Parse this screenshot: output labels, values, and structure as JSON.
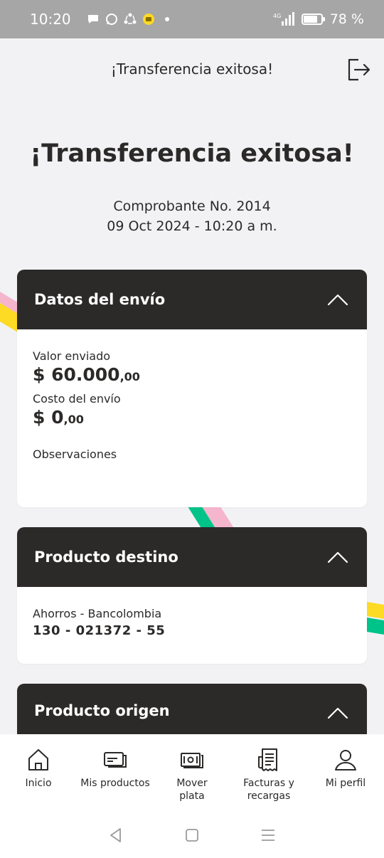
{
  "status_bar": {
    "time": "10:20",
    "battery": "78 %",
    "network": "4G",
    "battery_level": 0.78,
    "notification_icons": [
      "message-icon",
      "whatsapp-icon",
      "sync-icon",
      "app-icon",
      "dot-icon"
    ]
  },
  "top_bar": {
    "title": "¡Transferencia exitosa!"
  },
  "hero": {
    "title": "¡Transferencia exitosa!",
    "voucher": "Comprobante No. 2014",
    "date": "09 Oct 2024 - 10:20 a m."
  },
  "shipping": {
    "title": "Datos del envío",
    "value_label": "Valor enviado",
    "value_main": "$ 60.000",
    "value_cents": ",00",
    "cost_label": "Costo del envío",
    "cost_main": "$ 0",
    "cost_cents": ",00",
    "observations_label": "Observaciones"
  },
  "destination": {
    "title": "Producto destino",
    "account_type": "Ahorros - Bancolombia",
    "account_number": "130 - 021372 - 55"
  },
  "origin": {
    "title": "Producto origen"
  },
  "bottom_nav": {
    "home": "Inicio",
    "products": "Mis productos",
    "move_money": "Mover plata",
    "bills": "Facturas y recargas",
    "profile": "Mi perfil"
  },
  "colors": {
    "dark": "#2c2a29",
    "yellow": "#fdda24",
    "pink": "#f5b6cd",
    "green": "#00c389",
    "background": "#f2f2f4"
  }
}
